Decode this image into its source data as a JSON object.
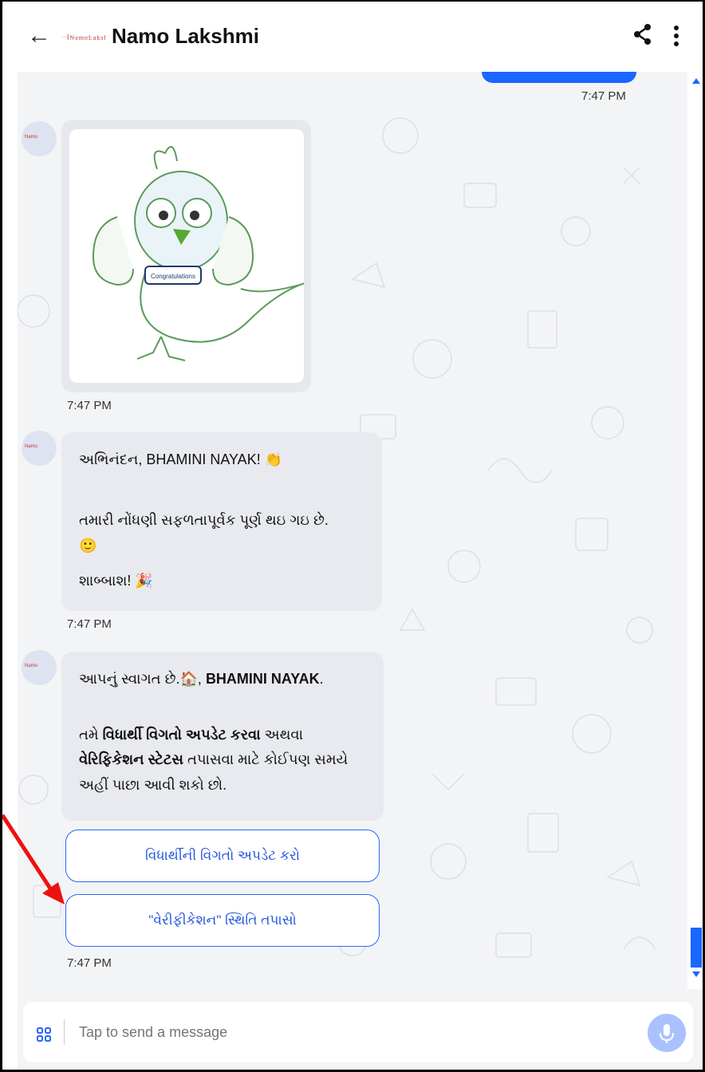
{
  "header": {
    "back_icon": "arrow-left-icon",
    "logo_text": "Namo Lakshmi",
    "title": "Namo Lakshmi",
    "share_icon": "share-icon",
    "menu_icon": "more-vertical-icon"
  },
  "colors": {
    "accent": "#1a66ff",
    "bubble": "#e8eaef",
    "chat_bg": "#f3f4f6",
    "annotation_arrow": "#e11"
  },
  "messages": {
    "sent_time": "7:47 PM",
    "sticker": {
      "badge_text": "Congratulations",
      "time": "7:47 PM"
    },
    "congrats": {
      "line1": "અભિનંદન, BHAMINI NAYAK! 👏",
      "line2": "તમારી નોંધણી સફળતાપૂર્વક પૂર્ણ થઇ ગઇ છે.",
      "line2_emoji": "🙂",
      "line3": "શાબ્બાશ! 🎉",
      "time": "7:47 PM"
    },
    "welcome": {
      "line1_prefix": "આપનું સ્વાગત છે.🏠, ",
      "line1_name": "BHAMINI NAYAK",
      "line1_suffix": ".",
      "p2_a": "તમે ",
      "p2_b": "વિધાર્થી વિગતો અપડેટ કરવા",
      "p2_c": " અથવા",
      "p3_a": "વેરિફિકેશન સ્ટેટસ",
      "p3_b": " તપાસવા માટે કોઈપણ સમયે",
      "p4": "અહીં પાછા આવી શકો છો."
    },
    "buttons": [
      {
        "label": "વિધાર્થીની વિગતો અપડેટ કરો"
      },
      {
        "label": "\"વેરીફીકેશન\" સ્થિતિ તપાસો"
      }
    ],
    "buttons_time": "7:47 PM"
  },
  "composer": {
    "apps_icon": "apps-grid-icon",
    "placeholder": "Tap to send a message",
    "mic_icon": "microphone-icon"
  }
}
